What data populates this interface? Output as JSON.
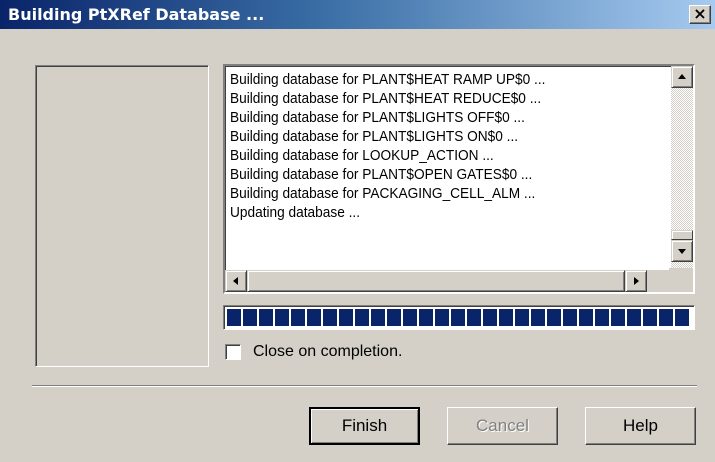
{
  "window": {
    "title": "Building PtXRef Database ...",
    "close_glyph": "×"
  },
  "log": {
    "lines": [
      "Building database for PLANT$HEAT RAMP UP$0 ...",
      "Building database for PLANT$HEAT REDUCE$0 ...",
      "Building database for PLANT$LIGHTS OFF$0 ...",
      "Building database for PLANT$LIGHTS ON$0 ...",
      "Building database for LOOKUP_ACTION ...",
      "Building database for PLANT$OPEN GATES$0 ...",
      "Building database for PACKAGING_CELL_ALM ...",
      "Updating database ..."
    ]
  },
  "progress": {
    "fraction": 1.0
  },
  "options": {
    "close_on_completion_label": "Close on completion.",
    "close_on_completion_checked": false
  },
  "buttons": {
    "finish": "Finish",
    "cancel": "Cancel",
    "help": "Help"
  },
  "colors": {
    "title_gradient_start": "#0a246a",
    "title_gradient_end": "#a6caf0",
    "progress_block": "#0a246a",
    "dialog_face": "#d4d0c8"
  },
  "icons": {
    "close": "close-icon",
    "scroll_up": "arrow-up-icon",
    "scroll_down": "arrow-down-icon",
    "scroll_left": "arrow-left-icon",
    "scroll_right": "arrow-right-icon"
  }
}
